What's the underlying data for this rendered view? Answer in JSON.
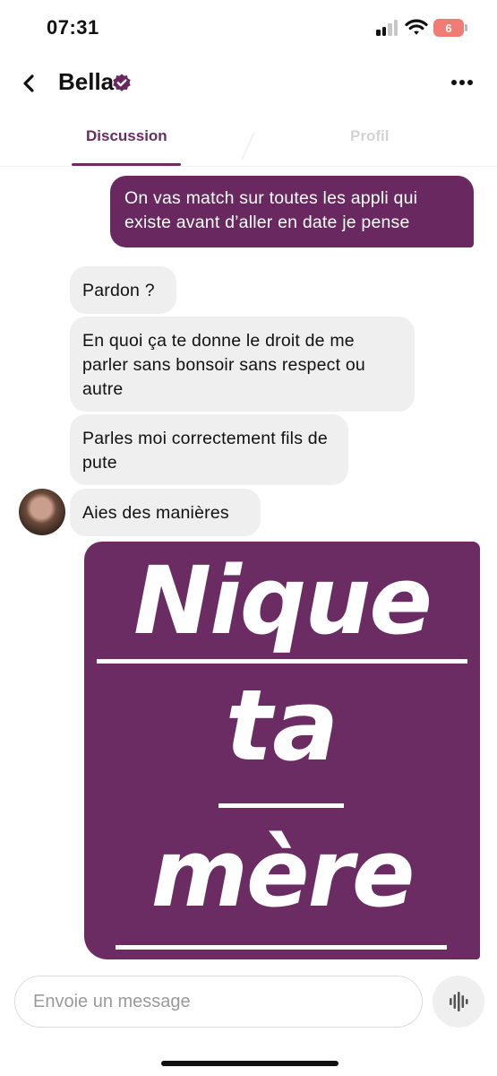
{
  "status_bar": {
    "time": "07:31",
    "battery": "6",
    "battery_color": "#f07d74",
    "signal_icon": "cellular-signal-icon",
    "wifi_icon": "wifi-icon"
  },
  "header": {
    "back_icon": "chevron-left-icon",
    "name": "Bella",
    "verified_icon": "verified-badge-icon",
    "more_icon": "more-horizontal-icon"
  },
  "tabs": [
    {
      "label": "Discussion",
      "active": true
    },
    {
      "label": "Profil",
      "active": false
    }
  ],
  "messages": [
    {
      "from": "me",
      "text": "On vas match sur toutes les appli qui existe avant d’aller en date je pense"
    },
    {
      "from": "Bella",
      "text": "Pardon ?"
    },
    {
      "from": "Bella",
      "text": "En quoi ça te donne le droit de me parler sans bonsoir sans respect ou autre"
    },
    {
      "from": "Bella",
      "text": "Parles moi correctement fils de pute"
    },
    {
      "from": "Bella",
      "text": "Aies des manières"
    }
  ],
  "sticker": {
    "from": "me",
    "words": [
      "Nique",
      "ta",
      "mère"
    ]
  },
  "composer": {
    "placeholder": "Envoie un message",
    "voice_icon": "voice-waveform-icon"
  },
  "colors": {
    "brand": "#69285f",
    "received_bubble": "#efefef",
    "inactive_tab": "#d4d4d4"
  }
}
